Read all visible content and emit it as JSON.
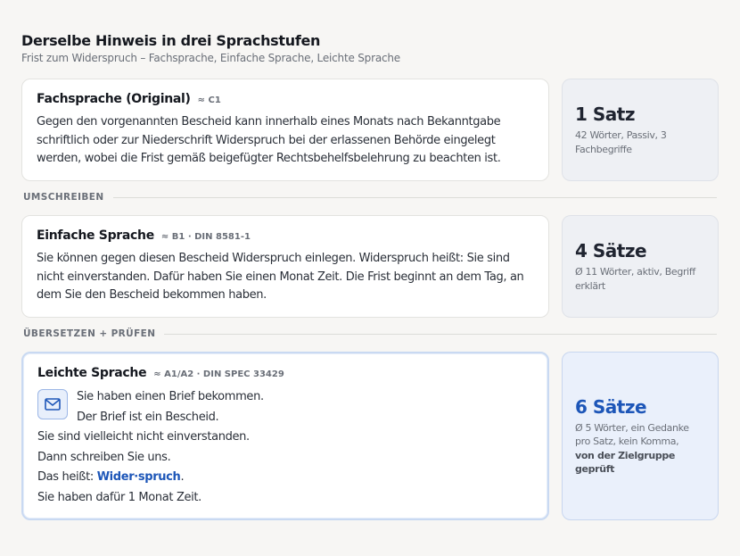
{
  "header": {
    "title": "Derselbe Hinweis in drei Sprachstufen",
    "subtitle": "Frist zum Widerspruch – Fachsprache, Einfache Sprache, Leichte Sprache"
  },
  "cards": [
    {
      "title": "Fachsprache (Original)",
      "level": "≈ C1",
      "text": "Gegen den vorgenannten Bescheid kann innerhalb eines Monats nach Bekanntgabe schriftlich oder zur Niederschrift Widerspruch bei der erlassenen Behörde eingelegt werden, wobei die Frist gemäß beigefügter Rechtsbehelfsbelehrung zu beachten ist.",
      "side_count": "1 Satz",
      "side_desc": "42 Wörter, Passiv, 3 Fachbegriffe"
    },
    {
      "title": "Einfache Sprache",
      "level": "≈ B1 · DIN 8581-1",
      "text": "Sie können gegen diesen Bescheid Widerspruch einlegen. Widerspruch heißt: Sie sind nicht einverstanden. Dafür haben Sie einen Monat Zeit. Die Frist beginnt an dem Tag, an dem Sie den Bescheid bekommen haben.",
      "side_count": "4 Sätze",
      "side_desc": "Ø 11 Wörter, aktiv, Begriff erklärt"
    },
    {
      "title": "Leichte Sprache",
      "level": "≈ A1/A2 · DIN SPEC 33429",
      "lines": [
        "Sie haben einen Brief bekommen.",
        "Der Brief ist ein Bescheid.",
        "Sie sind vielleicht nicht einverstanden.",
        "Dann schreiben Sie uns.",
        "Das heißt: ",
        "Wider·spruch",
        ".",
        "Sie haben dafür 1 Monat Zeit."
      ],
      "icon": "envelope-icon",
      "side_count": "6 Sätze",
      "side_desc": "Ø 5 Wörter, ein Gedanke pro Satz, kein Komma,",
      "side_strong": "von der Zielgruppe geprüft"
    }
  ],
  "dividers": [
    "UMSCHREIBEN",
    "ÜBERSETZEN + PRÜFEN"
  ],
  "colors": {
    "accent": "#1d56b8",
    "background": "#f7f6f4"
  }
}
